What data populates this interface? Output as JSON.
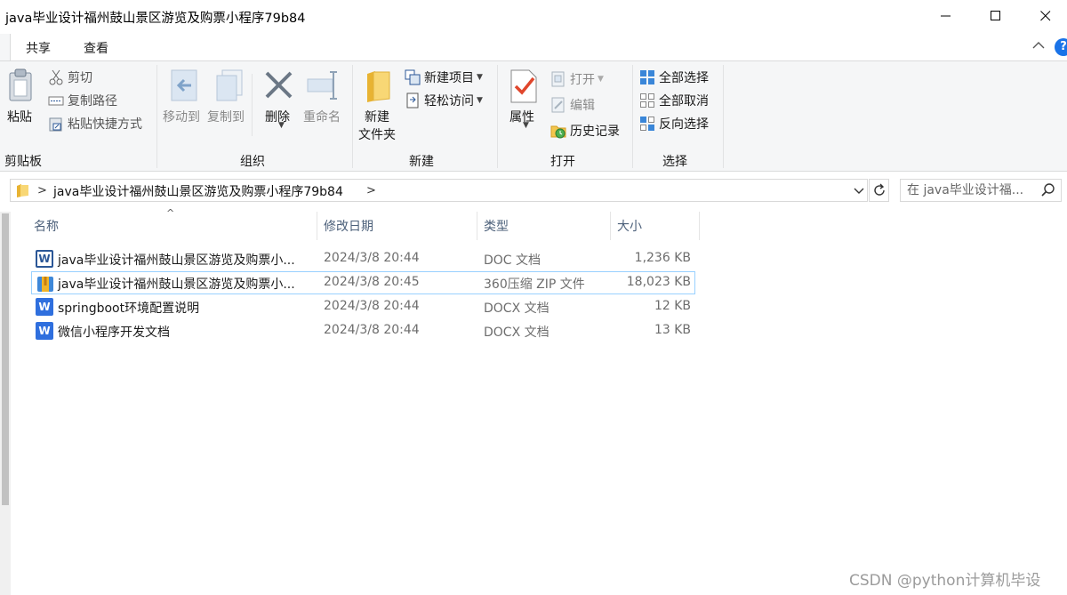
{
  "window": {
    "title": "java毕业设计福州鼓山景区游览及购票小程序79b84"
  },
  "ribbon_tabs": [
    "共享",
    "查看"
  ],
  "ribbon": {
    "clipboard": {
      "paste": "粘贴",
      "cut": "剪切",
      "copy_path": "复制路径",
      "paste_shortcut": "粘贴快捷方式",
      "label": "剪贴板"
    },
    "organize": {
      "move_to": "移动到",
      "copy_to": "复制到",
      "delete": "删除",
      "rename": "重命名",
      "label": "组织"
    },
    "new": {
      "new_folder_line1": "新建",
      "new_folder_line2": "文件夹",
      "new_item": "新建项目",
      "easy_access": "轻松访问",
      "label": "新建"
    },
    "open": {
      "properties": "属性",
      "open": "打开",
      "edit": "编辑",
      "history": "历史记录",
      "label": "打开"
    },
    "select": {
      "select_all": "全部选择",
      "select_none": "全部取消",
      "invert": "反向选择",
      "label": "选择"
    }
  },
  "address": {
    "path": "java毕业设计福州鼓山景区游览及购票小程序79b84",
    "search_placeholder": "在 java毕业设计福..."
  },
  "columns": {
    "name": "名称",
    "modified": "修改日期",
    "type": "类型",
    "size": "大小"
  },
  "files": [
    {
      "name": "java毕业设计福州鼓山景区游览及购票小...",
      "modified": "2024/3/8 20:44",
      "type": "DOC 文档",
      "size": "1,236 KB",
      "icon": "word-doc-icon"
    },
    {
      "name": "java毕业设计福州鼓山景区游览及购票小...",
      "modified": "2024/3/8 20:45",
      "type": "360压缩 ZIP 文件",
      "size": "18,023 KB",
      "icon": "zip-archive-icon"
    },
    {
      "name": "springboot环境配置说明",
      "modified": "2024/3/8 20:44",
      "type": "DOCX 文档",
      "size": "12 KB",
      "icon": "word-docx-icon"
    },
    {
      "name": "微信小程序开发文档",
      "modified": "2024/3/8 20:44",
      "type": "DOCX 文档",
      "size": "13 KB",
      "icon": "word-docx-icon"
    }
  ],
  "watermark": "CSDN @python计算机毕设",
  "colors": {
    "accent": "#1a73e8",
    "selection_border": "#99d1ff",
    "ribbon_bg": "#f5f6f7"
  }
}
